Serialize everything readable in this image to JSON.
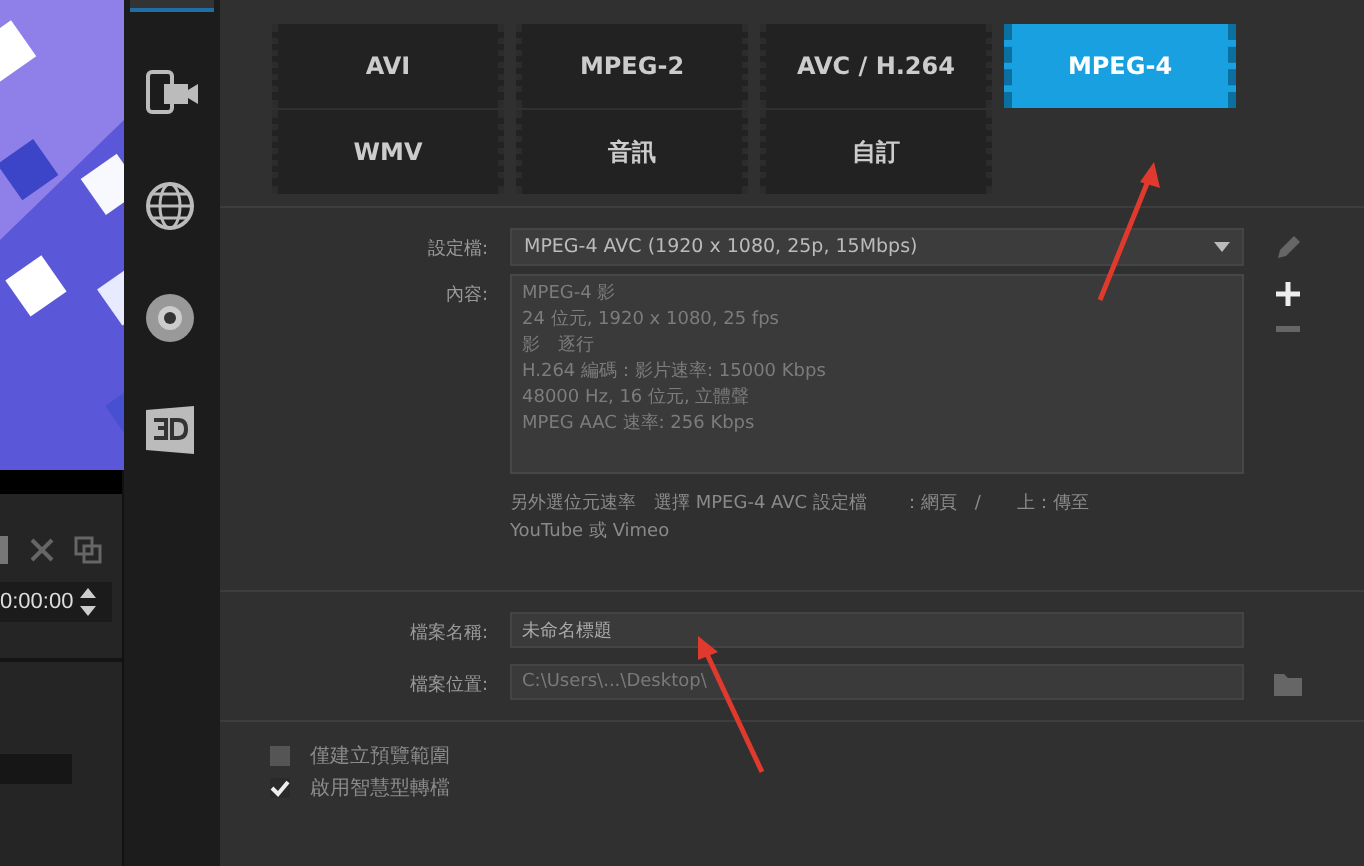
{
  "preview": {
    "timecode": "0:00:00"
  },
  "sidebar": {
    "items": [
      {
        "kind": "device",
        "selected": false
      },
      {
        "kind": "web",
        "selected": false
      },
      {
        "kind": "disc",
        "selected": false
      },
      {
        "kind": "stereo",
        "selected": false
      }
    ]
  },
  "formats": [
    {
      "label": "AVI",
      "selected": false
    },
    {
      "label": "MPEG-2",
      "selected": false
    },
    {
      "label": "AVC / H.264",
      "selected": false
    },
    {
      "label": "MPEG-4",
      "selected": true
    },
    {
      "label": "WMV",
      "selected": false
    },
    {
      "label": "音訊",
      "selected": false
    },
    {
      "label": "自訂",
      "selected": false
    }
  ],
  "profile": {
    "label": "設定檔:",
    "value": "MPEG-4 AVC (1920 x 1080, 25p, 15Mbps)"
  },
  "details": {
    "label": "內容:",
    "lines": [
      "MPEG-4 影",
      "24 位元, 1920 x 1080, 25 fps",
      "影　逐行",
      "H.264 編碼：影片速率: 15000 Kbps",
      "48000 Hz, 16 位元, 立體聲",
      "MPEG AAC 速率: 256 Kbps"
    ]
  },
  "note": [
    "另外選位元速率　選擇 MPEG-4 AVC 設定檔　　：網頁　/　　上：傳至",
    "YouTube 或 Vimeo"
  ],
  "file_name": {
    "label": "檔案名稱:",
    "value": "未命名標題"
  },
  "file_location": {
    "label": "檔案位置:",
    "value": "C:\\Users\\...\\Desktop\\"
  },
  "options": [
    {
      "label": "僅建立預覽範圍",
      "checked": false
    },
    {
      "label": "啟用智慧型轉檔",
      "checked": true
    }
  ],
  "annotations": [
    {
      "kind": "arrow"
    },
    {
      "kind": "arrow"
    }
  ]
}
